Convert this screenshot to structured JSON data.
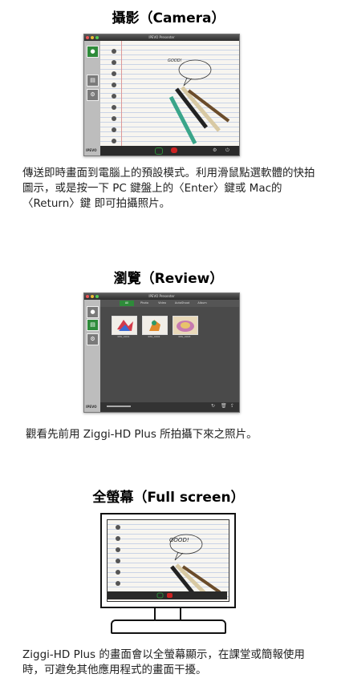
{
  "sections": {
    "camera": {
      "heading": "攝影（Camera）",
      "window_title": "IPEVO Presenter",
      "speech": "GOOD!",
      "description": "傳送即時畫面到電腦上的預設模式。利用滑鼠點選軟體的快拍圖示，或是按一下 PC 鍵盤上的〈Enter〉鍵或 Mac的〈Return〉鍵 即可拍攝照片。",
      "brand": "IPEVO"
    },
    "review": {
      "heading": "瀏覽（Review）",
      "window_title": "IPEVO Presenter",
      "tabs": [
        "All",
        "Photo",
        "Video",
        "AutoShoot",
        "Album"
      ],
      "thumbnails": [
        "IMG_0001",
        "IMG_0002",
        "IMG_0003"
      ],
      "description": "觀看先前用 Ziggi-HD Plus 所拍攝下來之照片。",
      "brand": "IPEVO"
    },
    "fullscreen": {
      "heading": "全螢幕（Full screen）",
      "speech": "GOOD!",
      "description": "Ziggi-HD Plus 的畫面會以全螢幕顯示，在課堂或簡報使用時，可避免其他應用程式的畫面干擾。"
    }
  },
  "colors": {
    "accent": "#2e8b3a",
    "window_bg": "#3e3e3e",
    "record": "#cc2222"
  }
}
